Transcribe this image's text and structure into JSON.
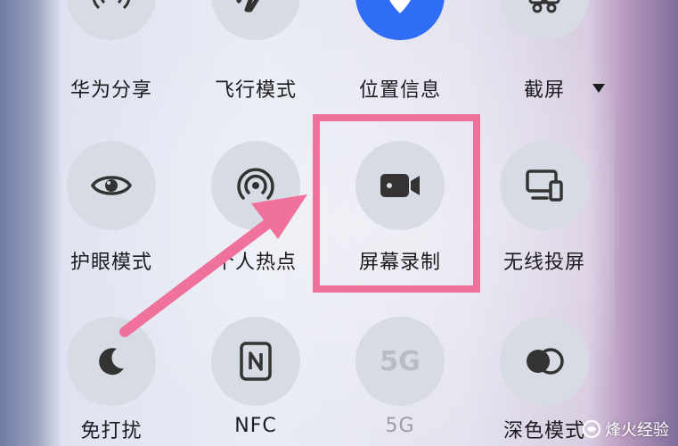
{
  "tiles": {
    "row1": {
      "huawei_share": "华为分享",
      "airplane": "飞行模式",
      "location": "位置信息",
      "screenshot": "截屏"
    },
    "row2": {
      "eye_comfort": "护眼模式",
      "hotspot": "个人热点",
      "screen_record": "屏幕录制",
      "wireless_projection": "无线投屏"
    },
    "row3": {
      "dnd": "免打扰",
      "nfc": "NFC",
      "five_g": "5G",
      "dark_mode": "深色模式"
    }
  },
  "icons": {
    "five_g_text": "5G"
  },
  "colors": {
    "active_tile": "#2f6df6",
    "highlight": "#f0719c",
    "tile_bg": "#d7dbe4"
  },
  "watermark": {
    "text": "烽火经验"
  }
}
